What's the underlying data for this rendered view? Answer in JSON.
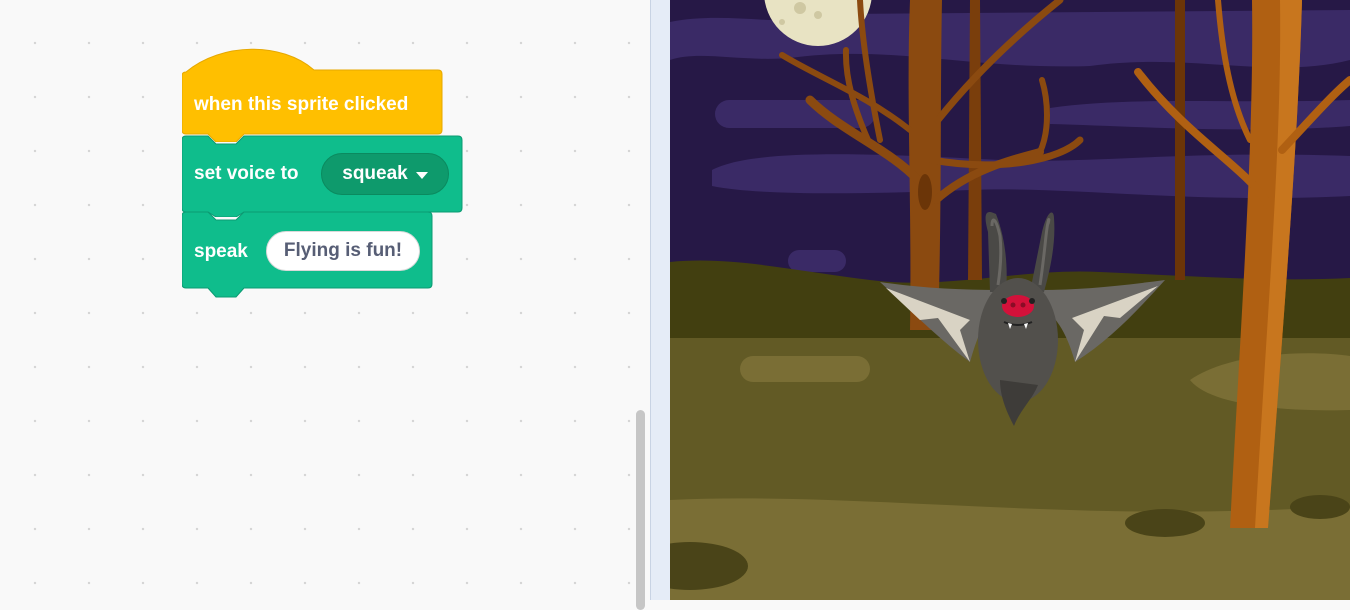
{
  "blocks": {
    "event": {
      "label": "when this sprite clicked",
      "color": "#ffbf00"
    },
    "set_voice": {
      "label": "set voice to",
      "value": "squeak",
      "color": "#0fbd8c"
    },
    "speak": {
      "label": "speak",
      "text": "Flying is fun!",
      "color": "#0fbd8c"
    }
  },
  "stage": {
    "sprite": "bat",
    "backdrop": "night woods"
  }
}
